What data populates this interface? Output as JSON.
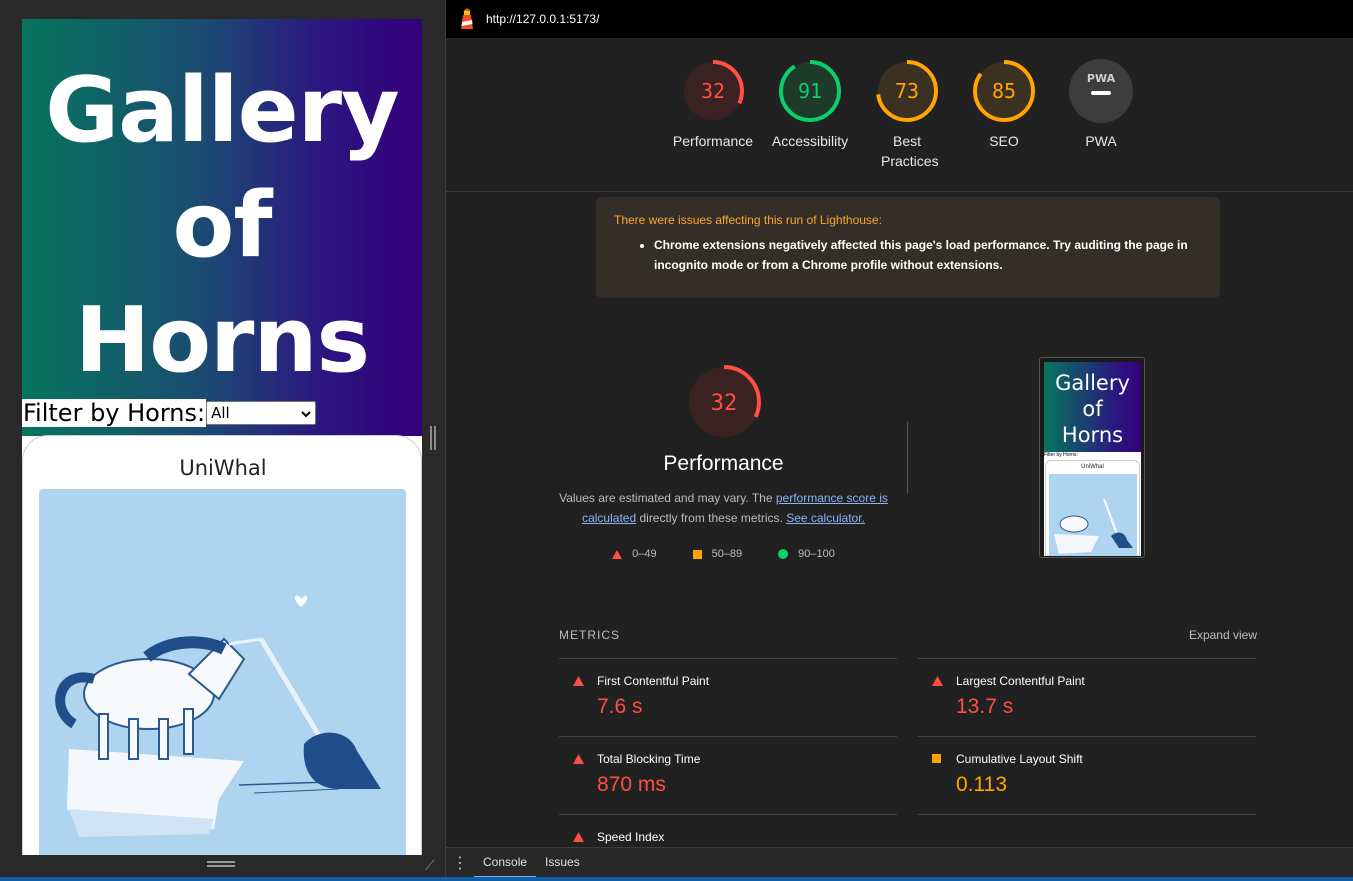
{
  "app": {
    "hero_title_lines": [
      "Gallery",
      "of",
      "Horns"
    ],
    "filter_label": "Filter by Horns:",
    "filter_selected": "All",
    "card_title": "UniWhal"
  },
  "devtools": {
    "url": "http://127.0.0.1:5173/",
    "gauges": [
      {
        "score": "32",
        "label": "Performance",
        "color": "#ff4e42",
        "fraction": 0.32
      },
      {
        "score": "91",
        "label": "Accessibility",
        "color": "#0cce6b",
        "fraction": 0.91
      },
      {
        "score": "73",
        "label": "Best Practices",
        "color": "#ffa400",
        "fraction": 0.73
      },
      {
        "score": "85",
        "label": "SEO",
        "color": "#ffa400",
        "fraction": 0.85
      },
      {
        "score": "PWA",
        "label": "PWA",
        "color": "#ffffff",
        "fraction": 0
      }
    ],
    "warning": {
      "title": "There were issues affecting this run of Lighthouse:",
      "item": "Chrome extensions negatively affected this page's load performance. Try auditing the page in incognito mode or from a Chrome profile without extensions."
    },
    "performance": {
      "score": "32",
      "title": "Performance",
      "desc_prefix": "Values are estimated and may vary. The ",
      "desc_link1": "performance score is calculated",
      "desc_mid": " directly from these metrics. ",
      "desc_link2": "See calculator.",
      "legend": [
        "0–49",
        "50–89",
        "90–100"
      ]
    },
    "thumbnail": {
      "title_lines": [
        "Gallery",
        "of",
        "Horns"
      ],
      "filter_label": "Filter by Horns:",
      "card_title": "UniWhal"
    },
    "metrics": {
      "header": "METRICS",
      "expand": "Expand view",
      "items": [
        {
          "name": "First Contentful Paint",
          "value": "7.6 s",
          "status": "fail"
        },
        {
          "name": "Largest Contentful Paint",
          "value": "13.7 s",
          "status": "fail"
        },
        {
          "name": "Total Blocking Time",
          "value": "870 ms",
          "status": "fail"
        },
        {
          "name": "Cumulative Layout Shift",
          "value": "0.113",
          "status": "average"
        },
        {
          "name": "Speed Index",
          "value": "",
          "status": "fail"
        }
      ]
    },
    "drawer_tabs": [
      "Console",
      "Issues"
    ],
    "colors": {
      "fail": "#ff4e42",
      "average": "#ffa400",
      "pass": "#0cce6b"
    }
  }
}
